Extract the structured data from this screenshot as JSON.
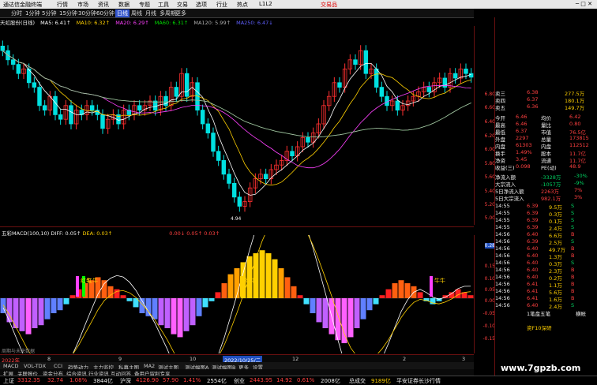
{
  "window": {
    "app_name": "通达信金融终端",
    "menus": [
      "行情",
      "市场",
      "资讯",
      "数据",
      "专题",
      "工具",
      "交易",
      "选项",
      "行业",
      "热点",
      "L1L2"
    ],
    "trade_label": "交易品",
    "controls": "─ □ ✕"
  },
  "toolbar": {
    "periods": [
      "分时",
      "1分钟",
      "5分钟",
      "15分钟",
      "30分钟",
      "60分钟",
      "日线",
      "周线",
      "月线",
      "多周期",
      "更多"
    ],
    "active": "日线"
  },
  "ma_legend": {
    "stock": "天虹股份(日线)",
    "items": [
      {
        "label": "MA5: 6.41↑",
        "color": "#ffffff"
      },
      {
        "label": "MA10: 6.32↑",
        "color": "#ffd000"
      },
      {
        "label": "MA20: 6.29↑",
        "color": "#ff40ff"
      },
      {
        "label": "MA60: 6.31↑",
        "color": "#00e000"
      },
      {
        "label": "MA120: 5.99↑",
        "color": "#b0b0b0"
      },
      {
        "label": "MA250: 6.47↓",
        "color": "#6060ff"
      }
    ]
  },
  "price_axis": [
    "6.80",
    "6.60",
    "6.40",
    "6.20",
    "6.00",
    "5.80",
    "5.60",
    "5.40",
    "5.20",
    "5.00"
  ],
  "low_marker": "4.94",
  "macd_legend": {
    "title": "五彩MACD(100,10)",
    "diff": "DIFF: 0.05↑",
    "dea": "DEA: 0.03↑",
    "extra": "0.00↓ 0.05↑ 0.03↑"
  },
  "macd_axis": [
    "0.28",
    "0.15",
    "0.10",
    "0.05",
    "0.00",
    "-0.05",
    "-0.10",
    "-0.15"
  ],
  "signals": [
    "红牛",
    "红牛",
    "红牛",
    "牛牛"
  ],
  "date_axis": {
    "year": "2022年",
    "labels": [
      "8",
      "9",
      "10",
      "11",
      "12",
      "2",
      "3"
    ],
    "highlight": "2022/10/25/二"
  },
  "tabs": [
    "扩展",
    "关联报价",
    "资金分布",
    "综合资讯",
    "行业资讯",
    "互动问答",
    "备用户留利专享"
  ],
  "tabs2": [
    "MACD",
    "VOL-TDX",
    "CCI",
    "趋势动力",
    "主力监控",
    "私募主图",
    "MA2",
    "测试主图",
    "测试幅图A",
    "测试幅图B",
    "更多",
    "设置"
  ],
  "bottom_hint": "周期与未来数据",
  "quote": {
    "asks": [
      {
        "label": "卖三",
        "price": "6.38",
        "vol": "277.5万"
      },
      {
        "label": "卖四",
        "price": "6.37",
        "vol": "180.1万"
      },
      {
        "label": "卖五",
        "price": "6.36",
        "vol": "149.7万"
      }
    ],
    "stats": [
      {
        "k": "今开",
        "v": "6.46",
        "k2": "均价",
        "v2": "6.42"
      },
      {
        "k": "最高",
        "v": "6.46",
        "k2": "量比",
        "v2": "0.80"
      },
      {
        "k": "最低",
        "v": "6.37",
        "k2": "市值",
        "v2": "76.5亿"
      },
      {
        "k": "外盘",
        "v": "2297",
        "k2": "总量",
        "v2": "173815"
      },
      {
        "k": "内盘",
        "v": "61303",
        "k2": "内盘",
        "v2": "112512"
      },
      {
        "k": "换手",
        "v": "1.49%",
        "k2": "股本",
        "v2": "11.7亿"
      },
      {
        "k": "净资",
        "v": "3.45",
        "k2": "流通",
        "v2": "11.7亿"
      },
      {
        "k": "收益(三)",
        "v": "0.098",
        "k2": "PE(动)",
        "v2": "48.9"
      }
    ],
    "flows": [
      {
        "k": "净流入额",
        "v": "-3328万",
        "p": "-30%"
      },
      {
        "k": "大宗流入",
        "v": "-1057万",
        "p": "-9%"
      },
      {
        "k": "5日净流入额",
        "v": "2263万",
        "p": "7%"
      },
      {
        "k": "5日大宗流入",
        "v": "982.1万",
        "p": "3%"
      }
    ],
    "ticks": [
      {
        "t": "14:55",
        "p": "6.39",
        "v": "9.5万",
        "s": "S"
      },
      {
        "t": "14:55",
        "p": "6.39",
        "v": "0.3万",
        "s": "S"
      },
      {
        "t": "14:55",
        "p": "6.39",
        "v": "0.1万",
        "s": "S"
      },
      {
        "t": "14:55",
        "p": "6.39",
        "v": "2.4万",
        "s": "S"
      },
      {
        "t": "14:56",
        "p": "6.40",
        "v": "6.6万",
        "s": "B"
      },
      {
        "t": "14:56",
        "p": "6.39",
        "v": "2.5万",
        "s": "S"
      },
      {
        "t": "14:56",
        "p": "6.40",
        "v": "49.7万",
        "s": "B"
      },
      {
        "t": "14:56",
        "p": "6.40",
        "v": "1.3万",
        "s": "B"
      },
      {
        "t": "14:56",
        "p": "6.40",
        "v": "0.3万",
        "s": "S"
      },
      {
        "t": "14:56",
        "p": "6.40",
        "v": "2.3万",
        "s": "B"
      },
      {
        "t": "14:56",
        "p": "6.40",
        "v": "0.2万",
        "s": "B"
      },
      {
        "t": "14:56",
        "p": "6.41",
        "v": "1.1万",
        "s": "B"
      },
      {
        "t": "14:56",
        "p": "6.41",
        "v": "5.6万",
        "s": "B"
      },
      {
        "t": "14:56",
        "p": "6.41",
        "v": "1.6万",
        "s": "B"
      },
      {
        "t": "14:56",
        "p": "6.40",
        "v": "2.4万",
        "s": "S"
      }
    ],
    "tick_tag": "1笔盘五笔",
    "footer_right": "横帐",
    "menu_right": "资F10深研"
  },
  "status": {
    "sh_label": "上证",
    "sh": "3312.35",
    "sh_chg": "32.74",
    "sh_pct": "1.08%",
    "sh_amt": "3844亿",
    "sz_label": "沪深",
    "sz": "4126.90",
    "sz_chg": "57.90",
    "sz_pct": "1.41%",
    "sz_amt": "2554亿",
    "cy_label": "创业",
    "cy": "2443.95",
    "cy_chg": "14.92",
    "cy_pct": "0.61%",
    "cy_amt": "2008亿",
    "total_label": "总成交",
    "total": "9189亿",
    "news": "平安证券长沙行情"
  },
  "watermark": "www.7gpzb.com",
  "chart_data": {
    "type": "candlestick",
    "ylim": [
      4.9,
      6.9
    ],
    "ma_series": [
      {
        "name": "MA5",
        "color": "#ffffff"
      },
      {
        "name": "MA10",
        "color": "#ffd000"
      },
      {
        "name": "MA20",
        "color": "#ff40ff"
      },
      {
        "name": "MA60",
        "color": "#00e000"
      },
      {
        "name": "MA120",
        "color": "#b0b0b0"
      }
    ],
    "closes": [
      6.7,
      6.6,
      6.55,
      6.45,
      6.5,
      6.35,
      6.3,
      6.1,
      6.05,
      6.2,
      6.0,
      5.95,
      6.1,
      5.9,
      6.05,
      6.0,
      6.1,
      6.05,
      6.0,
      5.85,
      5.95,
      6.0,
      5.9,
      6.05,
      6.0,
      6.1,
      6.05,
      6.1,
      6.15,
      6.05,
      6.2,
      6.1,
      6.3,
      6.2,
      6.45,
      6.2,
      6.35,
      6.05,
      5.9,
      5.8,
      5.6,
      5.5,
      5.35,
      5.25,
      5.1,
      5.0,
      5.05,
      5.2,
      5.3,
      5.35,
      5.3,
      5.4,
      5.45,
      5.5,
      5.6,
      5.55,
      5.65,
      5.75,
      5.7,
      5.8,
      5.9,
      6.1,
      6.2,
      6.35,
      6.3,
      6.5,
      6.6,
      6.55,
      6.7,
      6.45,
      6.5,
      6.3,
      6.2,
      6.1,
      6.15,
      6.05,
      6.1,
      6.15,
      6.2,
      6.25,
      6.3,
      6.25,
      6.35,
      6.4,
      6.3,
      6.45,
      6.4,
      6.5,
      6.45,
      6.41
    ],
    "macd_hist": [
      -0.05,
      -0.08,
      -0.1,
      -0.11,
      -0.12,
      -0.1,
      -0.09,
      -0.07,
      -0.05,
      -0.04,
      -0.02,
      0.01,
      0.03,
      0.05,
      0.06,
      0.07,
      0.06,
      0.04,
      0.03,
      0.01,
      -0.01,
      -0.03,
      -0.05,
      -0.06,
      -0.07,
      -0.09,
      -0.1,
      -0.12,
      -0.13,
      -0.11,
      -0.09,
      -0.06,
      -0.03,
      -0.01,
      0.02,
      0.05,
      0.08,
      0.1,
      0.12,
      0.14,
      0.15,
      0.16,
      0.15,
      0.13,
      0.1,
      0.07,
      0.04,
      0.01,
      -0.02,
      -0.05,
      -0.08,
      -0.1,
      -0.12,
      -0.14,
      -0.15,
      -0.13,
      -0.1,
      -0.07,
      -0.04,
      -0.02,
      0.01,
      0.03,
      0.05,
      0.06,
      0.05,
      0.04,
      0.02,
      -0.01,
      -0.02,
      -0.01,
      0.01,
      0.02,
      0.03,
      0.02,
      0.01
    ]
  }
}
